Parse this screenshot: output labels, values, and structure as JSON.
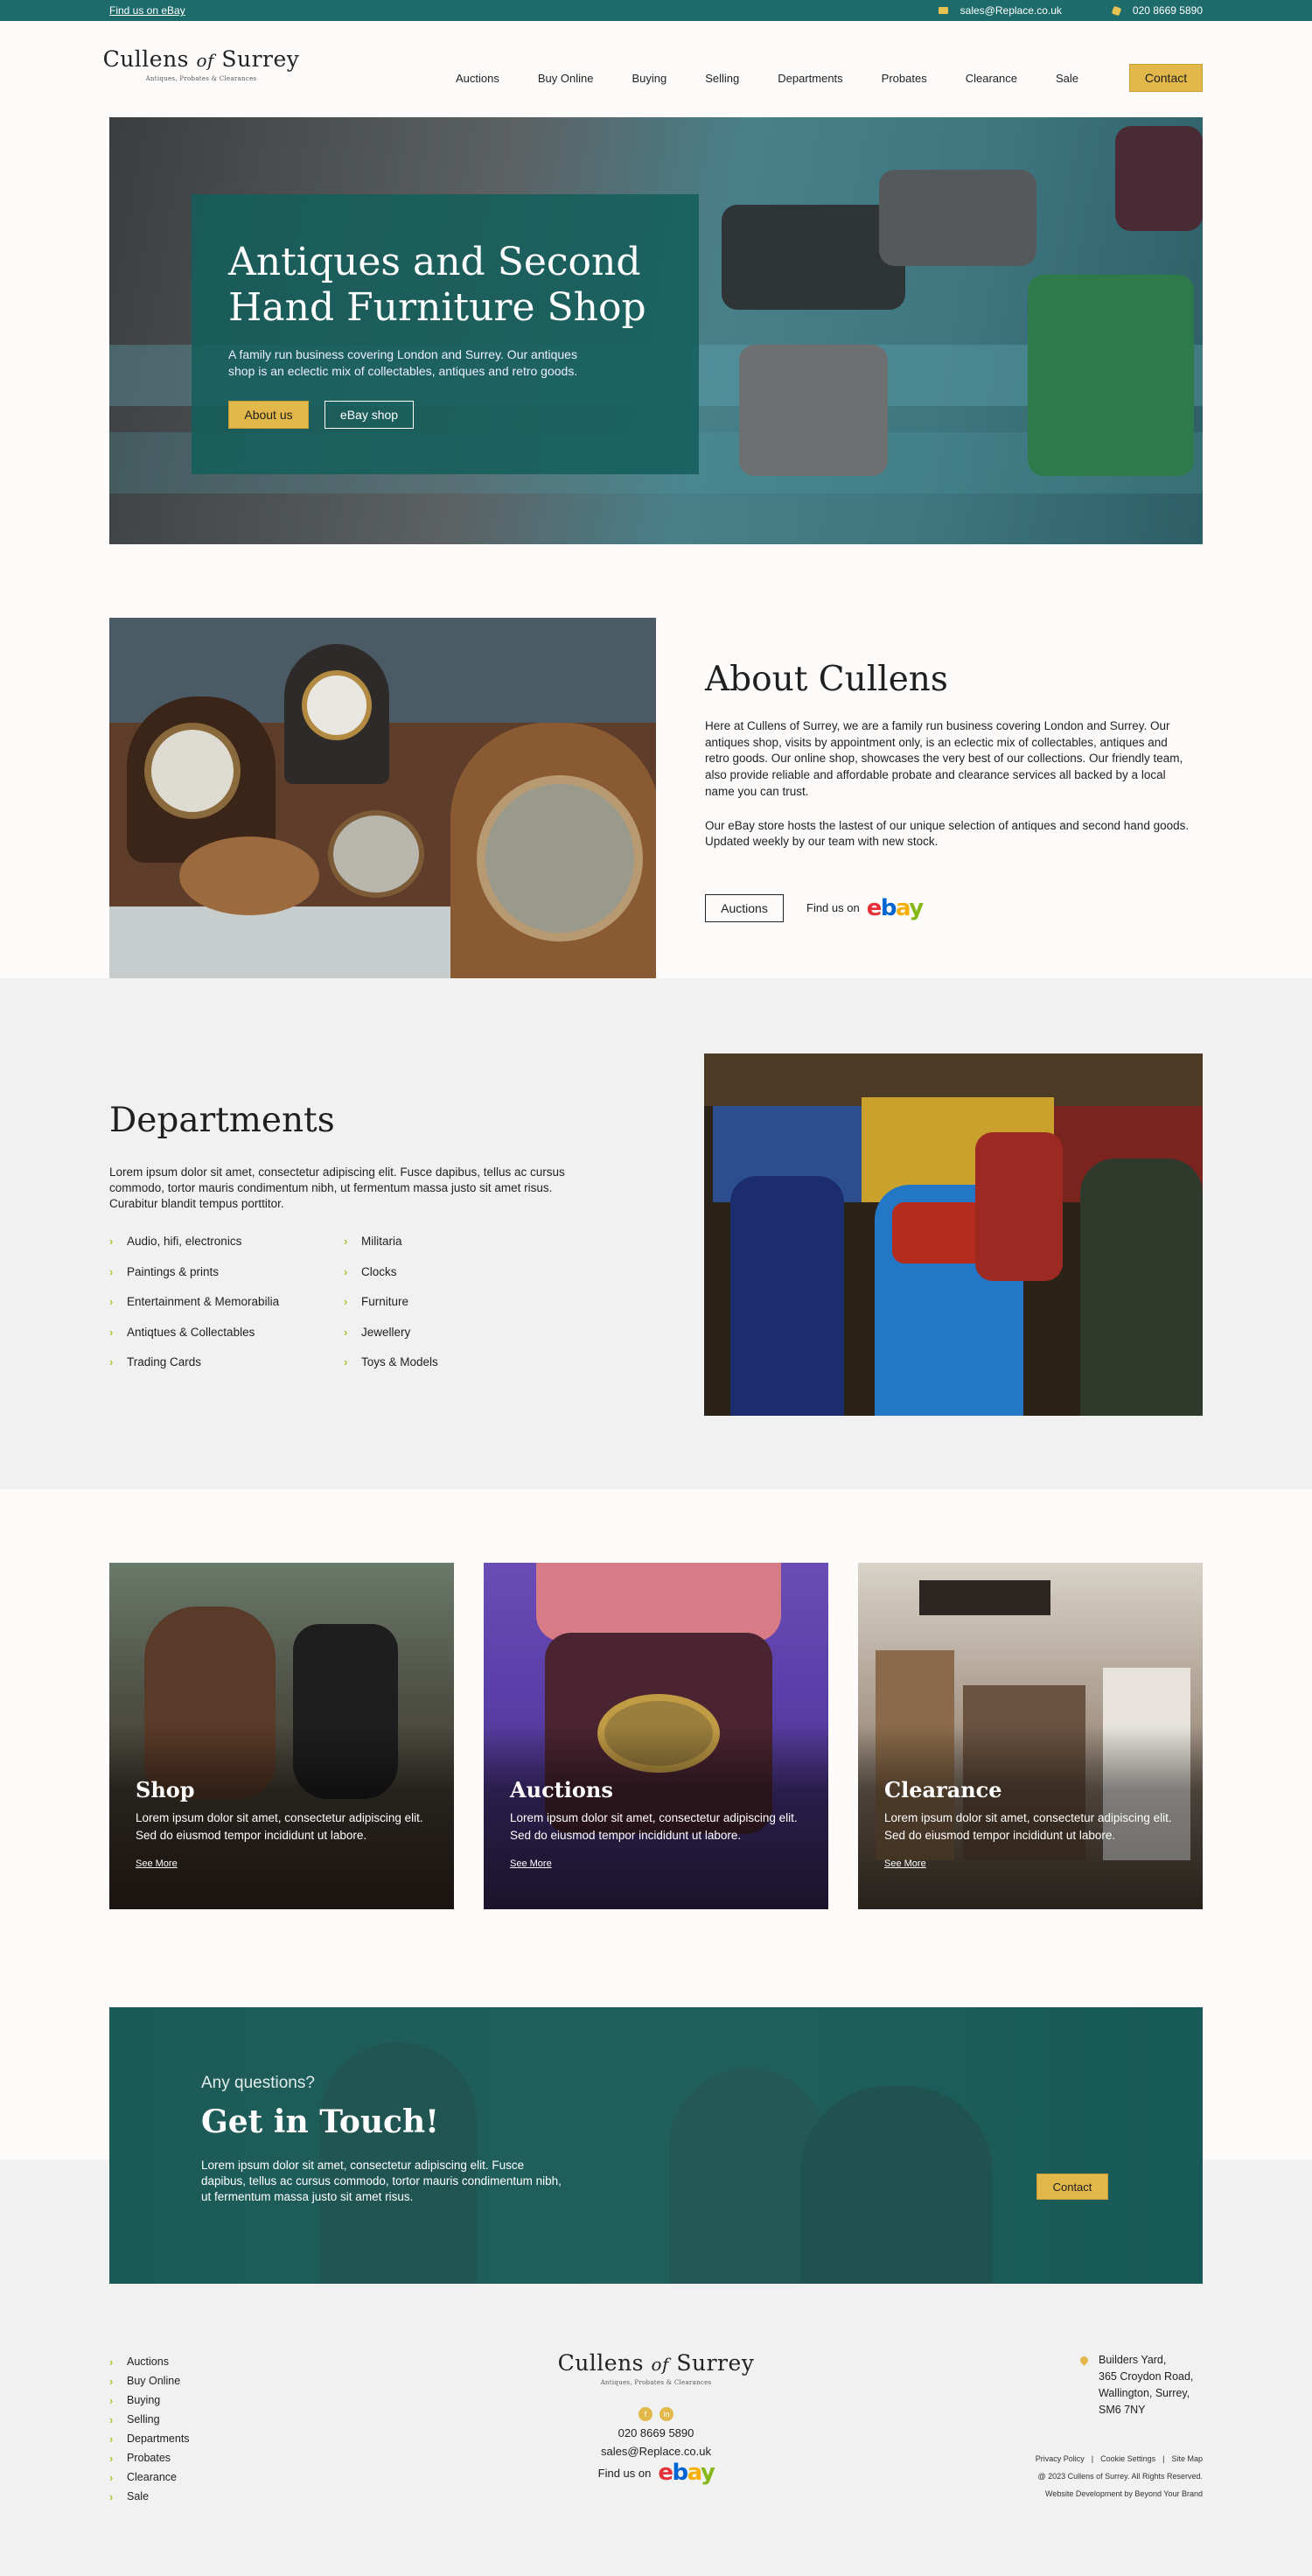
{
  "topbar": {
    "left_link": "Find us on eBay",
    "email": "sales@Replace.co.uk",
    "phone": "020 8669 5890"
  },
  "logo": {
    "part1": "Cullens",
    "part_of": "of",
    "part2": "Surrey",
    "tagline": "Antiques, Probates & Clearances"
  },
  "nav": {
    "items": [
      "Auctions",
      "Buy Online",
      "Buying",
      "Selling",
      "Departments",
      "Probates",
      "Clearance",
      "Sale"
    ],
    "contact": "Contact"
  },
  "hero": {
    "title_line1": "Antiques and Second",
    "title_line2": "Hand Furniture Shop",
    "text": "A family run business covering London and Surrey. Our antiques shop is an eclectic mix of collectables, antiques and retro goods.",
    "btn_about": "About us",
    "btn_ebay": "eBay shop"
  },
  "about": {
    "title": "About Cullens",
    "para1": "Here at Cullens of Surrey, we are a family run business covering London and Surrey. Our antiques shop, visits by appointment only, is an eclectic mix of collectables, antiques and retro goods. Our online shop, showcases the very best of our collections. Our friendly team, also provide reliable and affordable probate and clearance services all backed by a local name you can trust.",
    "para2": "Our eBay store hosts the lastest of our unique selection of antiques and second hand goods. Updated weekly by our team with new stock.",
    "btn_auctions": "Auctions",
    "find_us": "Find us on"
  },
  "departments": {
    "title": "Departments",
    "text": "Lorem ipsum dolor sit amet, consectetur adipiscing elit. Fusce dapibus, tellus ac cursus commodo, tortor mauris condimentum nibh, ut fermentum massa justo sit amet risus. Curabitur blandit tempus porttitor.",
    "items": [
      "Audio, hifi, electronics",
      "Militaria",
      "Paintings & prints",
      "Clocks",
      "Entertainment & Memorabilia",
      "Furniture",
      "Antiqtues & Collectables",
      "Jewellery",
      "Trading Cards",
      "Toys & Models"
    ]
  },
  "cards": [
    {
      "title": "Shop",
      "text": "Lorem ipsum dolor sit amet, consectetur adipiscing elit. Sed do eiusmod tempor incididunt ut labore.",
      "link": "See More"
    },
    {
      "title": "Auctions",
      "text": "Lorem ipsum dolor sit amet, consectetur adipiscing elit. Sed do eiusmod tempor incididunt ut labore.",
      "link": "See More"
    },
    {
      "title": "Clearance",
      "text": "Lorem ipsum dolor sit amet, consectetur adipiscing elit. Sed do eiusmod tempor incididunt ut labore.",
      "link": "See More"
    }
  ],
  "contact": {
    "pre": "Any questions?",
    "title": "Get in Touch!",
    "text": "Lorem ipsum dolor sit amet, consectetur adipiscing elit. Fusce dapibus, tellus ac cursus commodo, tortor mauris condimentum nibh, ut fermentum massa justo sit amet risus.",
    "button": "Contact"
  },
  "footer": {
    "links": [
      "Auctions",
      "Buy Online",
      "Buying",
      "Selling",
      "Departments",
      "Probates",
      "Clearance",
      "Sale"
    ],
    "phone": "020 8669 5890",
    "email": "sales@Replace.co.uk",
    "find_us": "Find us on",
    "address": [
      "Builders Yard,",
      "365 Croydon Road,",
      "Wallington, Surrey,",
      "SM6 7NY"
    ],
    "legal": {
      "privacy": "Privacy Policy",
      "cookie": "Cookie Settings",
      "sitemap": "Site Map",
      "copyright": "@ 2023 Cullens of Surrey. All Rights Reserved.",
      "credit": "Website Development by Beyond Your Brand"
    },
    "social_icons": [
      "facebook-icon",
      "linkedin-icon"
    ]
  },
  "ebay_logo": {
    "e": "e",
    "b": "b",
    "a": "a",
    "y": "y"
  },
  "colors": {
    "teal": "#1d6b6a",
    "gold": "#e3b84a",
    "chevron": "#b7c238",
    "grey_bg": "#f1f1f1"
  }
}
